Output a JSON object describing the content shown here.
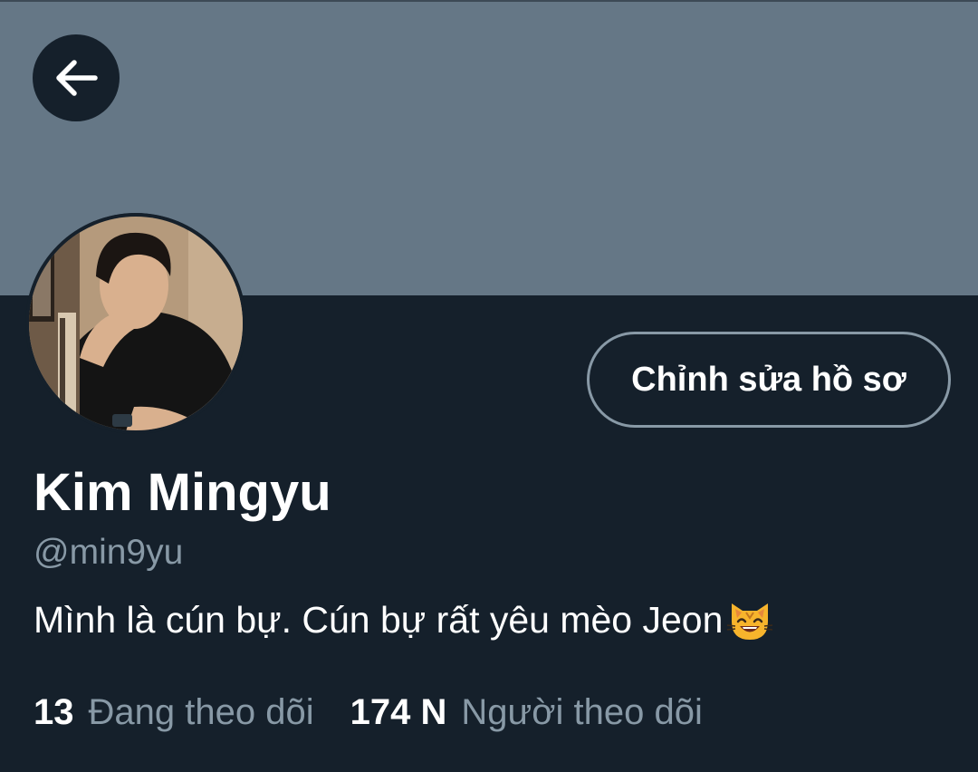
{
  "header": {
    "back_icon": "arrow-left-icon",
    "banner_color": "#657786"
  },
  "profile": {
    "avatar_alt": "profile photo",
    "edit_button_label": "Chỉnh sửa hồ sơ",
    "display_name": "Kim Mingyu",
    "handle": "@min9yu",
    "bio_text": "Mình là cún bự. Cún bự rất yêu mèo Jeon",
    "bio_emoji": "cat-face-icon"
  },
  "stats": {
    "following_count": "13",
    "following_label": "Đang theo dõi",
    "followers_count": "174 N",
    "followers_label": "Người theo dõi"
  },
  "colors": {
    "background": "#15202b",
    "secondary_text": "#8899a6",
    "primary_text": "#ffffff"
  }
}
